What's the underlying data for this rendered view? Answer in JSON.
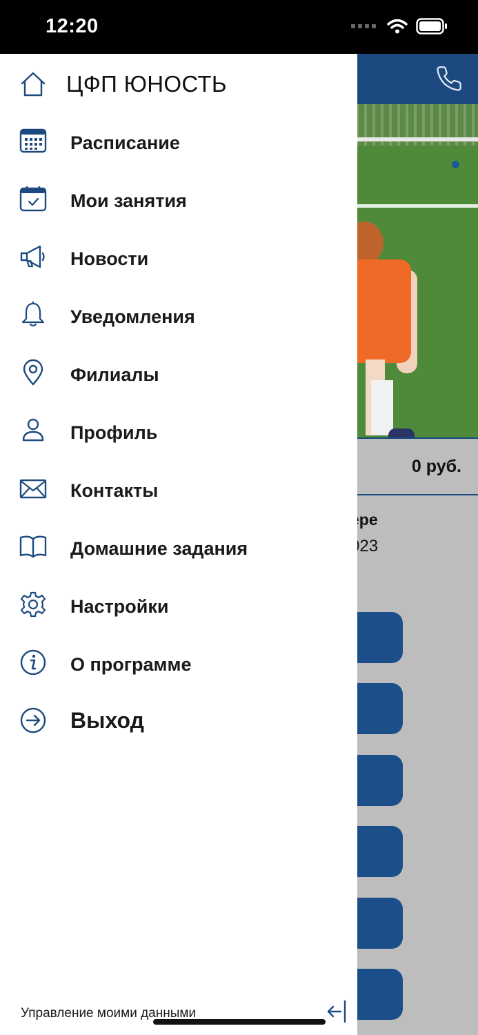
{
  "status_bar": {
    "time": "12:20"
  },
  "drawer": {
    "title": "ЦФП ЮНОСТЬ",
    "items": [
      {
        "label": "Расписание",
        "icon": "calendar-grid-icon"
      },
      {
        "label": "Мои занятия",
        "icon": "calendar-check-icon"
      },
      {
        "label": "Новости",
        "icon": "megaphone-icon"
      },
      {
        "label": "Уведомления",
        "icon": "bell-icon"
      },
      {
        "label": "Филиалы",
        "icon": "location-pin-icon"
      },
      {
        "label": "Профиль",
        "icon": "person-icon"
      },
      {
        "label": "Контакты",
        "icon": "envelope-icon"
      },
      {
        "label": "Домашние задания",
        "icon": "book-icon"
      },
      {
        "label": "Настройки",
        "icon": "gear-icon"
      },
      {
        "label": "О программе",
        "icon": "info-icon"
      },
      {
        "label": "Выход",
        "icon": "logout-icon"
      }
    ],
    "footer_link": "Управление моими данными"
  },
  "background": {
    "price": "0 руб.",
    "text_line1": "ере",
    "text_line2": "023"
  },
  "colors": {
    "accent": "#1c4a80",
    "icon": "#1c4a80",
    "button": "#1c4f8a"
  }
}
